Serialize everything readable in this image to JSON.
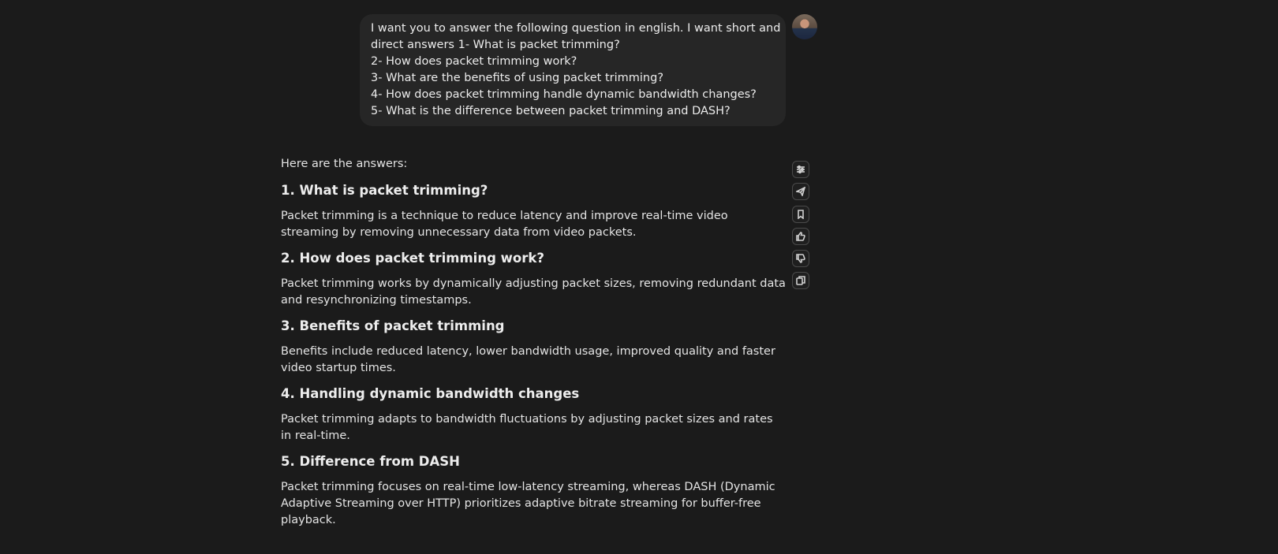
{
  "user_message": {
    "lines": [
      "I want you to answer the following question in english. I want short and",
      "direct answers 1- What is packet trimming?",
      "2- How does packet trimming work?",
      "3- What are the benefits of using packet trimming?",
      "4- How does packet trimming handle dynamic bandwidth changes?",
      "5- What is the difference between packet trimming and DASH?"
    ]
  },
  "assistant": {
    "intro": "Here are the answers:",
    "sections": [
      {
        "heading": "1. What is packet trimming?",
        "body": "Packet trimming is a technique to reduce latency and improve real-time video streaming by removing unnecessary data from video packets."
      },
      {
        "heading": "2. How does packet trimming work?",
        "body": "Packet trimming works by dynamically adjusting packet sizes, removing redundant data and resynchronizing timestamps."
      },
      {
        "heading": "3. Benefits of packet trimming",
        "body": "Benefits include reduced latency, lower bandwidth usage, improved quality and faster video startup times."
      },
      {
        "heading": "4. Handling dynamic bandwidth changes",
        "body": "Packet trimming adapts to bandwidth fluctuations by adjusting packet sizes and rates in real-time."
      },
      {
        "heading": "5. Difference from DASH",
        "body": "Packet trimming focuses on real-time low-latency streaming, whereas DASH (Dynamic Adaptive Streaming over HTTP) prioritizes adaptive bitrate streaming for buffer-free playback."
      }
    ]
  },
  "actions": [
    {
      "icon": "sliders-icon"
    },
    {
      "icon": "send-icon"
    },
    {
      "icon": "bookmark-icon"
    },
    {
      "icon": "thumbs-up-icon"
    },
    {
      "icon": "thumbs-down-icon"
    },
    {
      "icon": "copy-icon"
    }
  ]
}
